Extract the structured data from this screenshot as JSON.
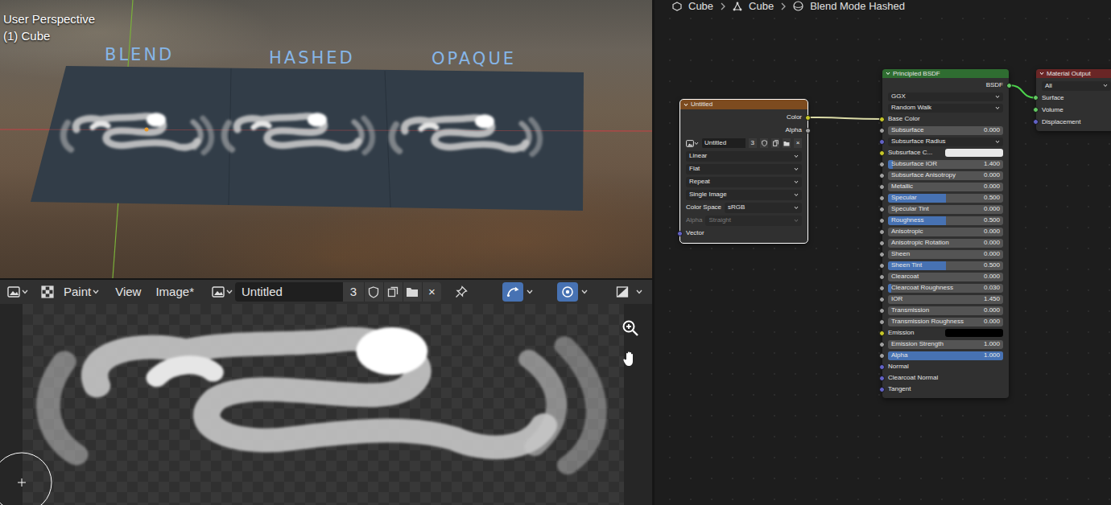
{
  "breadcrumb": [
    {
      "label": "Cube"
    },
    {
      "label": "Cube"
    },
    {
      "label": "Blend Mode Hashed"
    }
  ],
  "viewport": {
    "title": "User Perspective",
    "object": "(1) Cube",
    "annotations": [
      "BLEND",
      "HASHED",
      "OPAQUE"
    ]
  },
  "image_editor": {
    "mode": "Paint",
    "menus": [
      "View",
      "Image*"
    ],
    "image_name": "Untitled",
    "users": "3",
    "close": "×",
    "toggles": [
      {
        "on": true
      },
      {
        "on": true
      },
      {
        "on": false
      }
    ]
  },
  "nodes": [
    {
      "title": "Untitled",
      "selected": true,
      "rows": [
        {
          "kind": "output",
          "label": "Color",
          "socket": "#c7c729"
        },
        {
          "kind": "output",
          "label": "Alpha",
          "socket": "#a1a1a1"
        },
        {
          "kind": "image",
          "value": "Untitled",
          "users": "3",
          "close": "×"
        },
        {
          "kind": "dropdown",
          "value": "Linear"
        },
        {
          "kind": "dropdown",
          "value": "Flat"
        },
        {
          "kind": "dropdown",
          "value": "Repeat"
        },
        {
          "kind": "dropdown",
          "value": "Single Image"
        },
        {
          "kind": "field",
          "label": "Color Space",
          "value": "sRGB",
          "disabled": false
        },
        {
          "kind": "field",
          "label": "Alpha",
          "value": "Straight",
          "disabled": true
        },
        {
          "kind": "input",
          "label": "Vector",
          "socket": "#6363c7"
        }
      ]
    },
    {
      "title": "Principled BSDF",
      "selected": false,
      "rows": [
        {
          "kind": "output",
          "label": "BSDF",
          "socket": "#63c763"
        },
        {
          "kind": "dropdown",
          "value": "GGX"
        },
        {
          "kind": "dropdown",
          "value": "Random Walk"
        },
        {
          "kind": "input",
          "label": "Base Color",
          "socket": "#c7c729"
        },
        {
          "kind": "value",
          "label": "Subsurface",
          "value": "0.000",
          "level": 0,
          "socket": "#a1a1a1"
        },
        {
          "kind": "dropdown",
          "value": "Subsurface Radius",
          "socket": "#6363c7"
        },
        {
          "kind": "color",
          "label": "Subsurface C...",
          "swatch": "#e8e8e8",
          "socket": "#c7c729"
        },
        {
          "kind": "value",
          "label": "Subsurface IOR",
          "value": "1.400",
          "level": 0.04,
          "socket": "#a1a1a1"
        },
        {
          "kind": "value",
          "label": "Subsurface Anisotropy",
          "value": "0.000",
          "level": 0,
          "socket": "#a1a1a1"
        },
        {
          "kind": "value",
          "label": "Metallic",
          "value": "0.000",
          "level": 0,
          "socket": "#a1a1a1"
        },
        {
          "kind": "value",
          "label": "Specular",
          "value": "0.500",
          "level": 0.5,
          "socket": "#a1a1a1"
        },
        {
          "kind": "value",
          "label": "Specular Tint",
          "value": "0.000",
          "level": 0,
          "socket": "#a1a1a1"
        },
        {
          "kind": "value",
          "label": "Roughness",
          "value": "0.500",
          "level": 0.5,
          "socket": "#a1a1a1"
        },
        {
          "kind": "value",
          "label": "Anisotropic",
          "value": "0.000",
          "level": 0,
          "socket": "#a1a1a1"
        },
        {
          "kind": "value",
          "label": "Anisotropic Rotation",
          "value": "0.000",
          "level": 0,
          "socket": "#a1a1a1"
        },
        {
          "kind": "value",
          "label": "Sheen",
          "value": "0.000",
          "level": 0,
          "socket": "#a1a1a1"
        },
        {
          "kind": "value",
          "label": "Sheen Tint",
          "value": "0.500",
          "level": 0.5,
          "socket": "#a1a1a1"
        },
        {
          "kind": "value",
          "label": "Clearcoat",
          "value": "0.000",
          "level": 0,
          "socket": "#a1a1a1"
        },
        {
          "kind": "value",
          "label": "Clearcoat Roughness",
          "value": "0.030",
          "level": 0.03,
          "socket": "#a1a1a1"
        },
        {
          "kind": "value",
          "label": "IOR",
          "value": "1.450",
          "level": 0,
          "socket": "#a1a1a1"
        },
        {
          "kind": "value",
          "label": "Transmission",
          "value": "0.000",
          "level": 0,
          "socket": "#a1a1a1"
        },
        {
          "kind": "value",
          "label": "Transmission Roughness",
          "value": "0.000",
          "level": 0,
          "socket": "#a1a1a1"
        },
        {
          "kind": "color",
          "label": "Emission",
          "swatch": "#000000",
          "socket": "#c7c729"
        },
        {
          "kind": "value",
          "label": "Emission Strength",
          "value": "1.000",
          "level": 0,
          "socket": "#a1a1a1"
        },
        {
          "kind": "value",
          "label": "Alpha",
          "value": "1.000",
          "level": 1,
          "socket": "#a1a1a1"
        },
        {
          "kind": "input",
          "label": "Normal",
          "socket": "#6363c7"
        },
        {
          "kind": "input",
          "label": "Clearcoat Normal",
          "socket": "#6363c7"
        },
        {
          "kind": "input",
          "label": "Tangent",
          "socket": "#6363c7"
        }
      ]
    },
    {
      "title": "Material Output",
      "selected": false,
      "rows": [
        {
          "kind": "dropdown",
          "value": "All"
        },
        {
          "kind": "input",
          "label": "Surface",
          "socket": "#63c763"
        },
        {
          "kind": "input",
          "label": "Volume",
          "socket": "#63c763"
        },
        {
          "kind": "input",
          "label": "Displacement",
          "socket": "#6363c7"
        }
      ]
    }
  ],
  "links": [
    {
      "from": [
        0,
        0
      ],
      "to": [
        1,
        3
      ],
      "color": "#dcdca8"
    },
    {
      "from": [
        1,
        0
      ],
      "to": [
        2,
        1
      ],
      "color": "#4cd44c"
    }
  ]
}
